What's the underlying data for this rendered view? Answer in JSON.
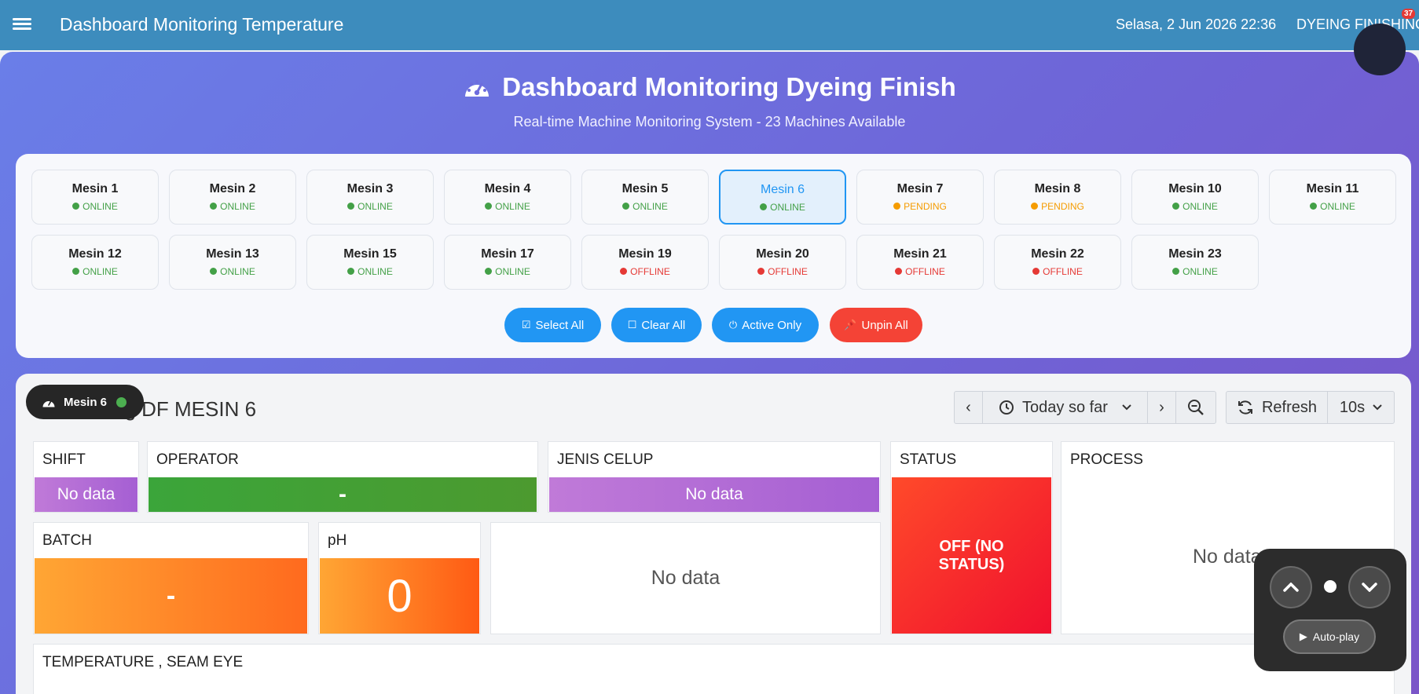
{
  "navbar": {
    "title": "Dashboard Monitoring Temperature",
    "datetime": "Selasa, 2 Jun 2026 22:36",
    "department": "DYEING FINISHING",
    "notification_count": "37"
  },
  "hero": {
    "title": "Dashboard Monitoring Dyeing Finish",
    "subtitle": "Real-time Machine Monitoring System - 23 Machines Available"
  },
  "machines": [
    {
      "name": "Mesin 1",
      "status": "ONLINE"
    },
    {
      "name": "Mesin 2",
      "status": "ONLINE"
    },
    {
      "name": "Mesin 3",
      "status": "ONLINE"
    },
    {
      "name": "Mesin 4",
      "status": "ONLINE"
    },
    {
      "name": "Mesin 5",
      "status": "ONLINE"
    },
    {
      "name": "Mesin 6",
      "status": "ONLINE",
      "selected": true
    },
    {
      "name": "Mesin 7",
      "status": "PENDING"
    },
    {
      "name": "Mesin 8",
      "status": "PENDING"
    },
    {
      "name": "Mesin 10",
      "status": "ONLINE"
    },
    {
      "name": "Mesin 11",
      "status": "ONLINE"
    },
    {
      "name": "Mesin 12",
      "status": "ONLINE"
    },
    {
      "name": "Mesin 13",
      "status": "ONLINE"
    },
    {
      "name": "Mesin 15",
      "status": "ONLINE"
    },
    {
      "name": "Mesin 17",
      "status": "ONLINE"
    },
    {
      "name": "Mesin 19",
      "status": "OFFLINE"
    },
    {
      "name": "Mesin 20",
      "status": "OFFLINE"
    },
    {
      "name": "Mesin 21",
      "status": "OFFLINE"
    },
    {
      "name": "Mesin 22",
      "status": "OFFLINE"
    },
    {
      "name": "Mesin 23",
      "status": "ONLINE"
    }
  ],
  "status_colors": {
    "ONLINE": "#43a047",
    "PENDING": "#f59c00",
    "OFFLINE": "#e53935"
  },
  "actions": {
    "select_all": "Select All",
    "clear_all": "Clear All",
    "active_only": "Active Only",
    "unpin_all": "Unpin All"
  },
  "dashboard": {
    "title_visible": "ng DF MESIN 6",
    "floating_tag": "Mesin 6",
    "time_range": "Today so far",
    "refresh_label": "Refresh",
    "refresh_interval": "10s"
  },
  "panels": {
    "shift": {
      "title": "SHIFT",
      "value": "No data"
    },
    "operator": {
      "title": "OPERATOR",
      "value": "-"
    },
    "jenis_celup": {
      "title": "JENIS CELUP",
      "value": "No data"
    },
    "status": {
      "title": "STATUS",
      "value": "OFF (NO STATUS)"
    },
    "process": {
      "title": "PROCESS",
      "value": "No data"
    },
    "batch": {
      "title": "BATCH",
      "value": "-"
    },
    "ph": {
      "title": "pH",
      "value": "0"
    },
    "unnamed": {
      "value": "No data"
    },
    "temperature": {
      "title": "TEMPERATURE , SEAM EYE"
    }
  },
  "nav_widget": {
    "autoplay": "Auto-play"
  }
}
